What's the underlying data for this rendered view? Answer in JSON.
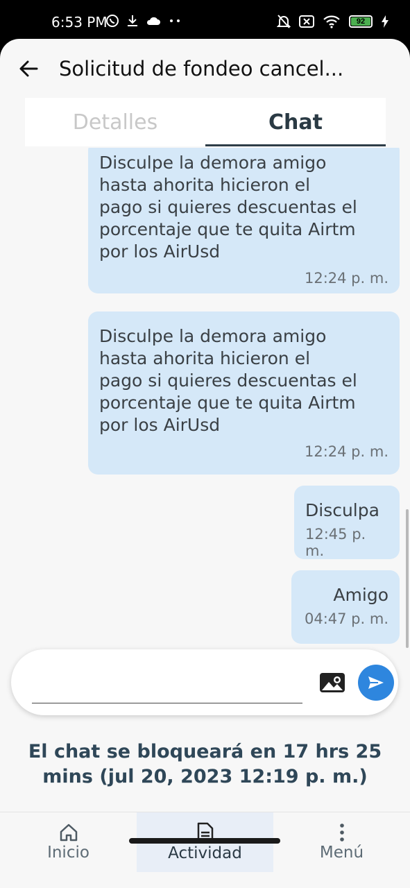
{
  "status_bar": {
    "time": "6:53 PM",
    "battery": "92",
    "left_icons": [
      "whatsapp-icon",
      "download-icon",
      "cloud-icon",
      "more-dots-icon"
    ],
    "right_icons": [
      "bell-muted-icon",
      "sim-x-icon",
      "wifi-icon",
      "battery-icon",
      "charging-icon"
    ]
  },
  "header": {
    "title": "Solicitud de fondeo cancel..."
  },
  "tabs": [
    {
      "label": "Detalles",
      "active": false
    },
    {
      "label": "Chat",
      "active": true
    }
  ],
  "messages": [
    {
      "text": "Disculpe la demora amigo\nhasta ahorita hicieron el\npago si quieres descuentas el\nporcentaje que te quita Airtm\npor los AirUsd",
      "time": "12:24 p. m."
    },
    {
      "text": "Disculpe la demora amigo\nhasta ahorita hicieron el\npago si quieres descuentas el\nporcentaje que te quita Airtm\npor los AirUsd",
      "time": "12:24 p. m."
    },
    {
      "text": "Disculpa",
      "time": "12:45 p. m."
    },
    {
      "text": "Amigo",
      "time": "04:47 p. m."
    }
  ],
  "composer": {
    "placeholder": "",
    "value": ""
  },
  "lock_notice": "El chat se bloqueará en 17 hrs 25 mins (jul 20, 2023 12:19 p. m.)",
  "bottom_nav": [
    {
      "label": "Inicio",
      "icon": "home-icon",
      "active": false
    },
    {
      "label": "Actividad",
      "icon": "document-icon",
      "active": true
    },
    {
      "label": "Menú",
      "icon": "more-vertical-icon",
      "active": false
    }
  ],
  "colors": {
    "bubble": "#d5e8f8",
    "send_button": "#2e86de",
    "accent_dark": "#2f4758",
    "active_nav_bg": "#e8eef7"
  }
}
